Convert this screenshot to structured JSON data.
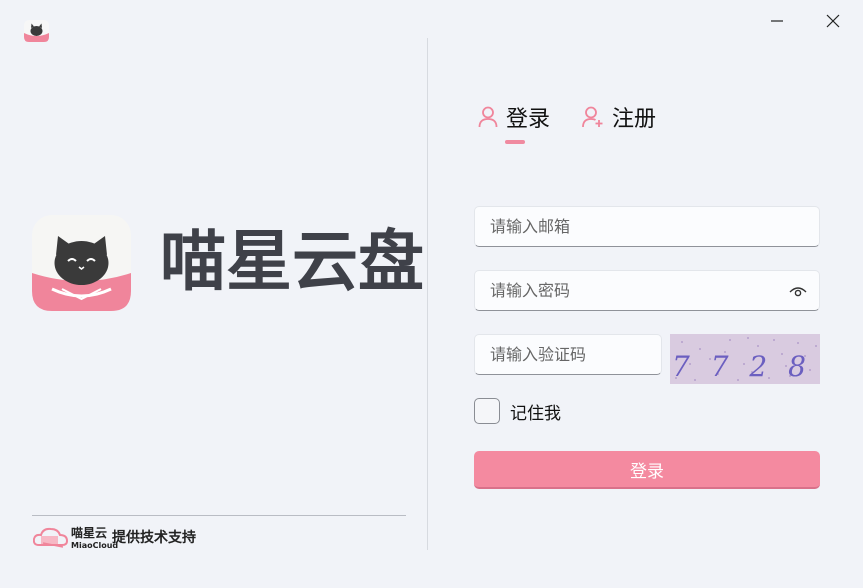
{
  "window": {
    "minimize_label": "minimize",
    "close_label": "close"
  },
  "brand": {
    "name": "喵星云盘"
  },
  "footer": {
    "brand_cn": "喵星云",
    "brand_en": "MiaoCloud",
    "support_text": "提供技术支持"
  },
  "tabs": {
    "login": "登录",
    "register": "注册"
  },
  "form": {
    "email_placeholder": "请输入邮箱",
    "password_placeholder": "请输入密码",
    "captcha_placeholder": "请输入验证码",
    "captcha_text": "7 7 2 8",
    "remember_label": "记住我",
    "submit_label": "登录"
  },
  "colors": {
    "accent": "#f48aa0",
    "background": "#f1f3f8",
    "brand_text": "#3f4149"
  },
  "icons": {
    "app": "cat-logo-icon",
    "login_tab": "user-icon",
    "register_tab": "user-add-icon",
    "password_toggle": "eye-icon"
  }
}
